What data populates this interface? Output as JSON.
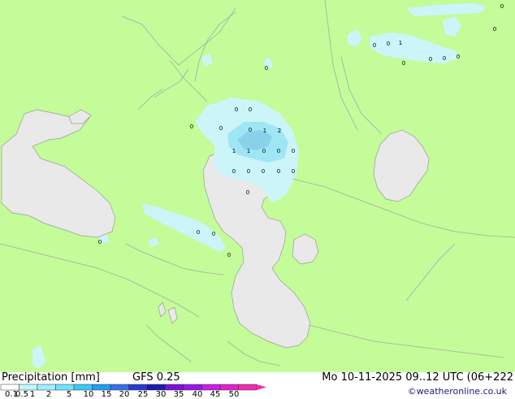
{
  "legend": {
    "title": "Precipitation [mm]",
    "model": "GFS 0.25",
    "datetime": "Mo 10-11-2025 09..12 UTC (06+222",
    "credit": "©weatheronline.co.uk",
    "scale_values": [
      "0.1",
      "0.5",
      "1",
      "2",
      "5",
      "10",
      "15",
      "20",
      "25",
      "30",
      "35",
      "40",
      "45",
      "50"
    ],
    "scale_colors": [
      "#ffffff",
      "#bff7ff",
      "#9ef0ff",
      "#6fe3ff",
      "#38c8f5",
      "#1f9df0",
      "#3a6ee8",
      "#2a3ad6",
      "#1b1bb0",
      "#7a10d8",
      "#9a16e6",
      "#c81ee6",
      "#e220cc",
      "#f02bb0"
    ]
  },
  "map": {
    "land_color": "#c3fc98",
    "water_color": "#e9e9e9",
    "precip_light_color": "#ccf5fa",
    "precip_medium_color": "#9fe6f5",
    "precip_heavy_color": "#87d2ea",
    "station_values": [
      "0",
      "0",
      "1",
      "0",
      "0",
      "0",
      "0",
      "0",
      "0",
      "0",
      "0",
      "0",
      "1",
      "2",
      "1",
      "1",
      "0",
      "0",
      "0",
      "0",
      "0",
      "0",
      "0",
      "0",
      "0",
      "0",
      "0",
      "0",
      "0",
      "0",
      "0",
      "0"
    ]
  }
}
